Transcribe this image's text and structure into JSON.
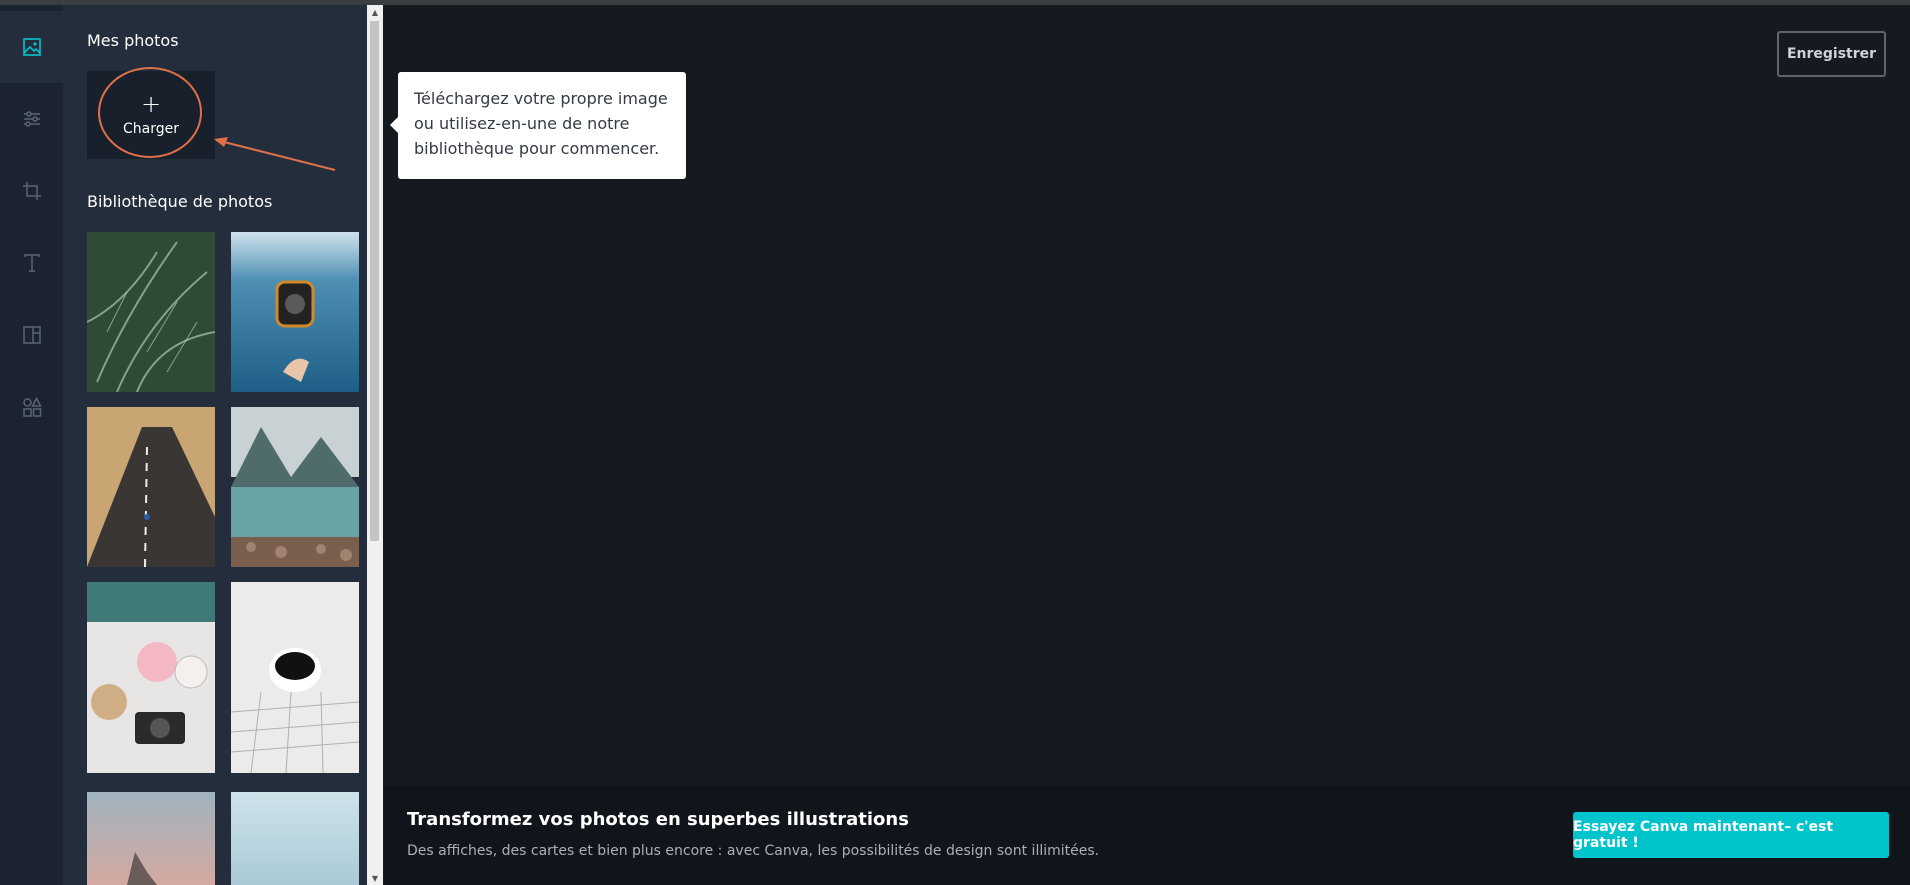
{
  "colors": {
    "background": "#151a21",
    "rail": "#1b2330",
    "panel": "#232d3b",
    "accent": "#00c4cc",
    "annotation": "#e0704a"
  },
  "rail": {
    "items": [
      {
        "name": "photos-icon",
        "active": true
      },
      {
        "name": "adjust-sliders-icon",
        "active": false
      },
      {
        "name": "crop-icon",
        "active": false
      },
      {
        "name": "text-icon",
        "active": false
      },
      {
        "name": "frame-icon",
        "active": false
      },
      {
        "name": "shapes-icon",
        "active": false
      }
    ]
  },
  "panel": {
    "my_photos_title": "Mes photos",
    "upload": {
      "plus": "+",
      "label": "Charger"
    },
    "library_title": "Bibliothèque de photos",
    "photos": [
      {
        "name": "palm-leaves-photo"
      },
      {
        "name": "camera-in-water-photo"
      },
      {
        "name": "desert-road-photo"
      },
      {
        "name": "mountain-lake-photo"
      },
      {
        "name": "coffee-camera-flowers-photo"
      },
      {
        "name": "coffee-cup-photo"
      },
      {
        "name": "sunset-clouds-photo"
      },
      {
        "name": "sky-photo"
      }
    ]
  },
  "tooltip": {
    "line1": "Téléchargez votre propre image",
    "line2": "ou utilisez-en-une de notre",
    "line3": "bibliothèque pour commencer."
  },
  "header": {
    "save_label": "Enregistrer"
  },
  "footer": {
    "title": "Transformez vos photos en superbes illustrations",
    "subtitle": "Des affiches, des cartes et bien plus encore : avec Canva, les possibilités de design sont illimitées.",
    "cta_label": "Essayez Canva maintenant– c'est gratuit !"
  }
}
